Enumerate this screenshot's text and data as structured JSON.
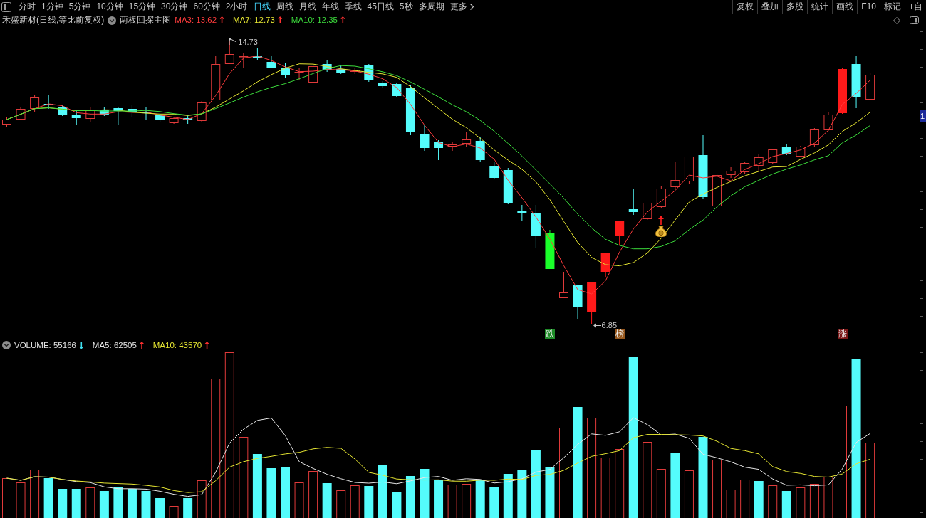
{
  "toolbar": {
    "periods": [
      {
        "label": "分时",
        "selected": false
      },
      {
        "label": "1分钟",
        "selected": false
      },
      {
        "label": "5分钟",
        "selected": false
      },
      {
        "label": "10分钟",
        "selected": false
      },
      {
        "label": "15分钟",
        "selected": false
      },
      {
        "label": "30分钟",
        "selected": false
      },
      {
        "label": "60分钟",
        "selected": false
      },
      {
        "label": "2小时",
        "selected": false
      },
      {
        "label": "日线",
        "selected": true
      },
      {
        "label": "周线",
        "selected": false
      },
      {
        "label": "月线",
        "selected": false
      },
      {
        "label": "年线",
        "selected": false
      },
      {
        "label": "季线",
        "selected": false
      },
      {
        "label": "45日线",
        "selected": false
      },
      {
        "label": "5秒",
        "selected": false
      },
      {
        "label": "多周期",
        "selected": false
      }
    ],
    "more_menu": {
      "label": "更多"
    },
    "tools": [
      "复权",
      "叠加",
      "多股",
      "统计",
      "画线",
      "F10",
      "标记",
      "+自"
    ]
  },
  "main_chart": {
    "title": "禾盛新材(日线,等比前复权)",
    "indicator": "两板回探主图",
    "legend": [
      {
        "label": "MA3: 13.62",
        "color": "#ff3c3c",
        "arrow": {
          "text": "↑",
          "color": "#ff3030"
        }
      },
      {
        "label": "MA7: 12.73",
        "color": "#e6e632",
        "arrow": {
          "text": "↑",
          "color": "#ff3030"
        }
      },
      {
        "label": "MA10: 12.35",
        "color": "#3cdc3c",
        "arrow": {
          "text": "↑",
          "color": "#ff3030"
        }
      }
    ],
    "high_label": "14.73",
    "low_label": "6.85",
    "signals": [
      {
        "label": "跌",
        "color": "#1e8c28"
      },
      {
        "label": "榜",
        "color": "#94561c"
      },
      {
        "label": "涨",
        "color": "#7a1616"
      }
    ],
    "price_axis_label": "1"
  },
  "volume_chart": {
    "legend": [
      {
        "label": "VOLUME: 55166",
        "color": "#e6e6e6",
        "arrow": {
          "text": "↓",
          "color": "#40e0f0"
        }
      },
      {
        "label": "MA5: 62505",
        "color": "#e6e6e6",
        "arrow": {
          "text": "↑",
          "color": "#ff3030"
        }
      },
      {
        "label": "MA10: 43570",
        "color": "#e6e632",
        "arrow": {
          "text": "↑",
          "color": "#ff3030"
        }
      }
    ]
  }
}
